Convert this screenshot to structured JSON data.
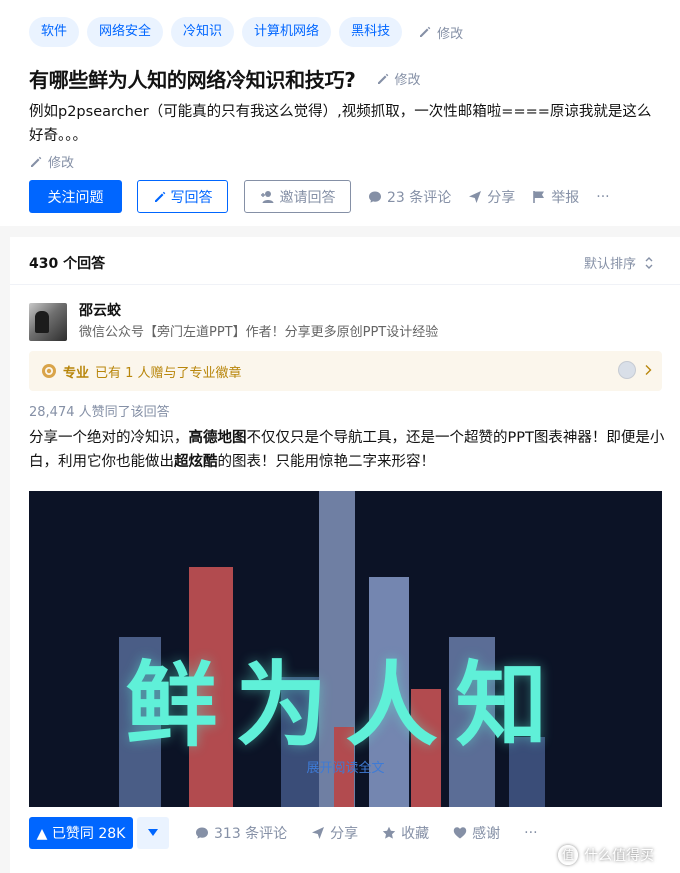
{
  "question": {
    "tags": [
      "软件",
      "网络安全",
      "冷知识",
      "计算机网络",
      "黑科技"
    ],
    "tags_edit": "修改",
    "title": "有哪些鲜为人知的网络冷知识和技巧?",
    "title_edit": "修改",
    "detail": "例如p2psearcher（可能真的只有我这么觉得）,视频抓取，一次性邮箱啦====原谅我就是这么好奇。。。",
    "detail_edit": "修改",
    "actions": {
      "follow": "关注问题",
      "write": "写回答",
      "invite": "邀请回答",
      "comments": "23 条评论",
      "share": "分享",
      "report": "举报",
      "more": "···"
    }
  },
  "answers_header": {
    "count": "430 个回答",
    "sort": "默认排序"
  },
  "answer": {
    "author_name": "邵云蛟",
    "author_bio": "微信公众号【旁门左道PPT】作者！分享更多原创PPT设计经验",
    "badge_tag": "专业",
    "badge_text": "已有 1 人赠与了专业徽章",
    "vote_meta": "28,474 人赞同了该回答",
    "text_1": "分享一个绝对的冷知识，",
    "text_bold_1": "高德地图",
    "text_2": "不仅仅只是个导航工具，还是一个超赞的PPT图表神器！即便是小白，利用它你也能做出",
    "text_bold_2": "超炫酷",
    "text_3": "的图表！只能用惊艳二字来形容！",
    "image_text": "鲜为人知",
    "expand": "展开阅读全文",
    "vote_up": "▲ 已赞同 28K",
    "comments": "313 条评论",
    "share": "分享",
    "collect": "收藏",
    "thanks": "感谢",
    "more": "···"
  },
  "watermark": {
    "logo": "值",
    "text": "什么值得买"
  },
  "colors": {
    "brand_blue": "#0066ff",
    "tag_bg": "#eaf3ff",
    "meta_gray": "#8590a6",
    "badge_gold": "#b8860b"
  }
}
